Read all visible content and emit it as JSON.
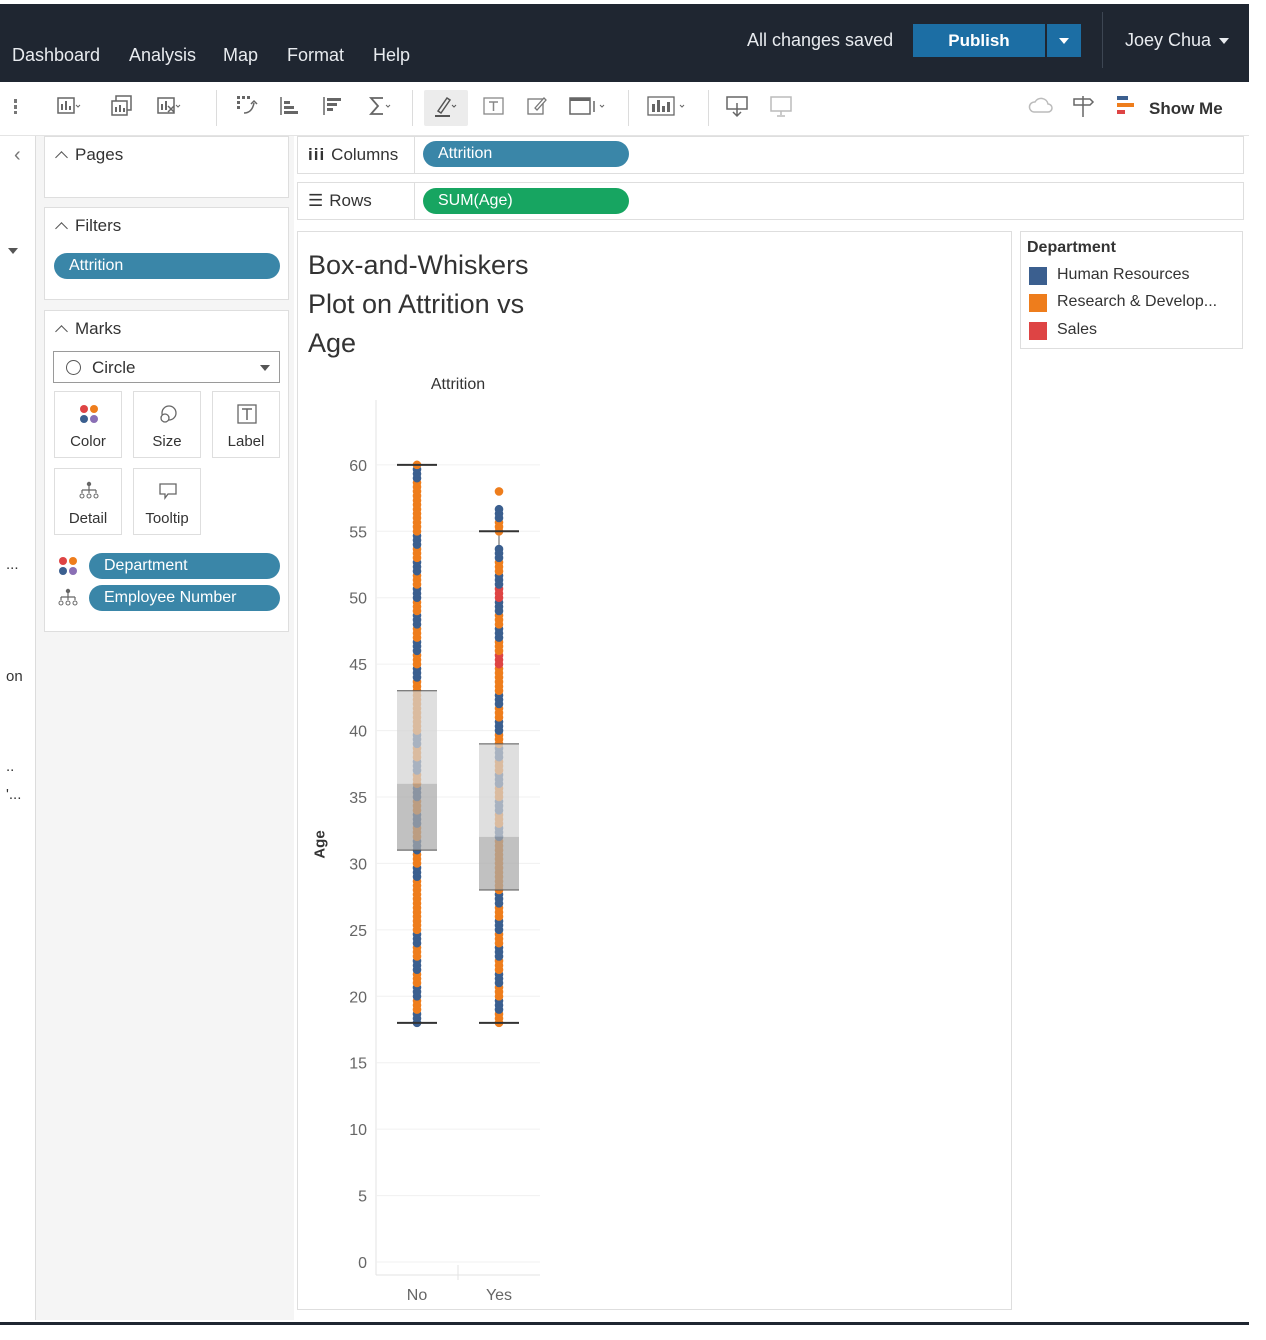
{
  "menu": [
    "Dashboard",
    "Analysis",
    "Map",
    "Format",
    "Help"
  ],
  "topbar": {
    "status": "All changes saved",
    "publish_label": "Publish",
    "user": "Joey Chua"
  },
  "toolbar": {
    "show_me_label": "Show Me"
  },
  "left_strip": {
    "labels": [
      "...",
      "on",
      "..",
      "'..."
    ]
  },
  "cards": {
    "pages_title": "Pages",
    "filters_title": "Filters",
    "filters": [
      "Attrition"
    ],
    "marks_title": "Marks",
    "mark_type": "Circle",
    "mark_buttons": [
      "Color",
      "Size",
      "Label",
      "Detail",
      "Tooltip"
    ],
    "mark_fields": [
      "Department",
      "Employee Number"
    ]
  },
  "shelves": {
    "columns_label": "Columns",
    "columns_pill": "Attrition",
    "rows_label": "Rows",
    "rows_pill": "SUM(Age)"
  },
  "sheet": {
    "title": "Box-and-Whiskers Plot on Attrition vs Age"
  },
  "legend": {
    "title": "Department",
    "items": [
      {
        "label": "Human Resources",
        "color": "#3b5f8f"
      },
      {
        "label": "Research & Develop...",
        "color": "#ee7d1c"
      },
      {
        "label": "Sales",
        "color": "#de4444"
      }
    ]
  },
  "chart_data": {
    "type": "scatter",
    "title": "Box-and-Whiskers Plot on Attrition vs Age",
    "column_header": "Attrition",
    "xlabel": "",
    "ylabel": "Age",
    "categories": [
      "No",
      "Yes"
    ],
    "ylim": [
      0,
      63
    ],
    "y_ticks": [
      0,
      5,
      10,
      15,
      20,
      25,
      30,
      35,
      40,
      45,
      50,
      55,
      60
    ],
    "grid": true,
    "legend_position": "right",
    "boxes": [
      {
        "category": "No",
        "whisker_low": 18,
        "q1": 31,
        "median": 36,
        "q3": 43,
        "whisker_high": 60
      },
      {
        "category": "Yes",
        "whisker_low": 18,
        "q1": 28,
        "median": 32,
        "q3": 39,
        "whisker_high": 55
      }
    ],
    "points": [
      {
        "category": "No",
        "dept_colors": "mixed",
        "ages": [
          18,
          19,
          20,
          21,
          22,
          23,
          24,
          25,
          26,
          27,
          28,
          29,
          30,
          31,
          32,
          33,
          34,
          35,
          36,
          37,
          38,
          39,
          40,
          41,
          42,
          43,
          44,
          45,
          46,
          47,
          48,
          49,
          50,
          51,
          52,
          53,
          54,
          55,
          56,
          57,
          58,
          59,
          60
        ]
      },
      {
        "category": "Yes",
        "dept_colors": "mixed",
        "ages": [
          18,
          19,
          20,
          21,
          22,
          23,
          24,
          25,
          26,
          27,
          28,
          29,
          30,
          31,
          32,
          33,
          34,
          35,
          36,
          37,
          38,
          39,
          40,
          41,
          42,
          43,
          44,
          45,
          46,
          47,
          48,
          49,
          50,
          51,
          52,
          53,
          55,
          56,
          58
        ]
      }
    ]
  }
}
